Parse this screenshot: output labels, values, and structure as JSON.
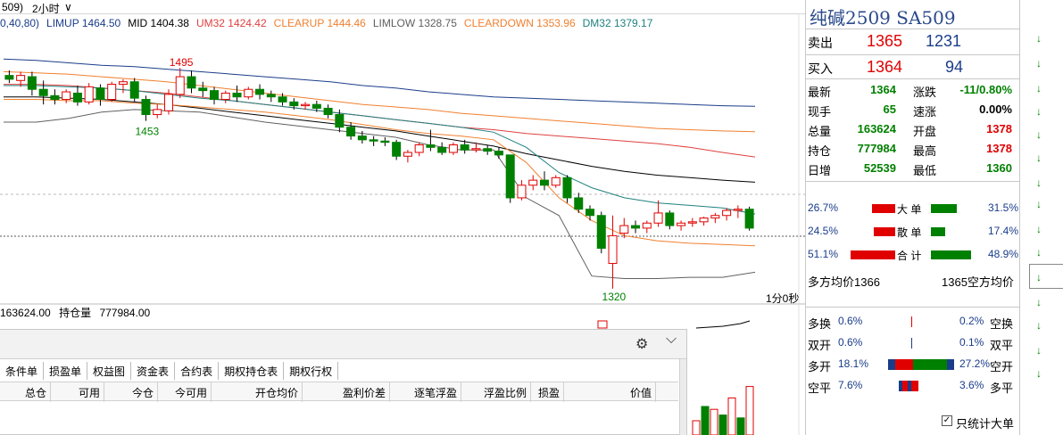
{
  "topbar": {
    "period_prefix": "509)",
    "period_select": "2小时",
    "chevron": "∨"
  },
  "indicators": [
    {
      "text": "0,40,80)",
      "color": "#1a3d8a"
    },
    {
      "text": "LIMUP 1464.50",
      "color": "#1a3d8a"
    },
    {
      "text": "MID 1404.38",
      "color": "#000000"
    },
    {
      "text": "UM32 1424.42",
      "color": "#e04040"
    },
    {
      "text": "CLEARUP 1444.46",
      "color": "#f08030"
    },
    {
      "text": "LIMLOW 1328.75",
      "color": "#606060"
    },
    {
      "text": "CLEARDOWN 1353.96",
      "color": "#f08030"
    },
    {
      "text": "DM32 1379.17",
      "color": "#208080"
    }
  ],
  "chart_data": {
    "type": "candlestick",
    "price_range": [
      1310,
      1505
    ],
    "labels": {
      "high": "1495",
      "low_left": "1453",
      "low": "1320"
    },
    "time_label": "1分0秒",
    "candles": [
      {
        "o": 1489,
        "h": 1493,
        "c": 1486,
        "l": 1483
      },
      {
        "o": 1485,
        "h": 1492,
        "c": 1489,
        "l": 1480
      },
      {
        "o": 1488,
        "h": 1492,
        "c": 1478,
        "l": 1473
      },
      {
        "o": 1478,
        "h": 1485,
        "c": 1473,
        "l": 1466
      },
      {
        "o": 1473,
        "h": 1478,
        "c": 1470,
        "l": 1466
      },
      {
        "o": 1470,
        "h": 1478,
        "c": 1476,
        "l": 1467
      },
      {
        "o": 1475,
        "h": 1481,
        "c": 1468,
        "l": 1465
      },
      {
        "o": 1468,
        "h": 1483,
        "c": 1480,
        "l": 1466
      },
      {
        "o": 1479,
        "h": 1482,
        "c": 1470,
        "l": 1465
      },
      {
        "o": 1470,
        "h": 1484,
        "c": 1482,
        "l": 1468
      },
      {
        "o": 1482,
        "h": 1486,
        "c": 1484,
        "l": 1475
      },
      {
        "o": 1484,
        "h": 1487,
        "c": 1471,
        "l": 1468
      },
      {
        "o": 1470,
        "h": 1473,
        "c": 1458,
        "l": 1453
      },
      {
        "o": 1458,
        "h": 1466,
        "c": 1462,
        "l": 1455
      },
      {
        "o": 1461,
        "h": 1478,
        "c": 1474,
        "l": 1458
      },
      {
        "o": 1474,
        "h": 1495,
        "c": 1488,
        "l": 1471
      },
      {
        "o": 1488,
        "h": 1493,
        "c": 1479,
        "l": 1475
      },
      {
        "o": 1479,
        "h": 1484,
        "c": 1477,
        "l": 1472
      },
      {
        "o": 1477,
        "h": 1480,
        "c": 1470,
        "l": 1466
      },
      {
        "o": 1470,
        "h": 1477,
        "c": 1475,
        "l": 1467
      },
      {
        "o": 1475,
        "h": 1481,
        "c": 1472,
        "l": 1468
      },
      {
        "o": 1472,
        "h": 1480,
        "c": 1478,
        "l": 1470
      },
      {
        "o": 1478,
        "h": 1482,
        "c": 1474,
        "l": 1470
      },
      {
        "o": 1474,
        "h": 1477,
        "c": 1472,
        "l": 1468
      },
      {
        "o": 1472,
        "h": 1475,
        "c": 1468,
        "l": 1465
      },
      {
        "o": 1468,
        "h": 1471,
        "c": 1465,
        "l": 1462
      },
      {
        "o": 1465,
        "h": 1468,
        "c": 1466,
        "l": 1462
      },
      {
        "o": 1466,
        "h": 1469,
        "c": 1463,
        "l": 1460
      },
      {
        "o": 1463,
        "h": 1466,
        "c": 1458,
        "l": 1455
      },
      {
        "o": 1458,
        "h": 1462,
        "c": 1448,
        "l": 1444
      },
      {
        "o": 1448,
        "h": 1452,
        "c": 1441,
        "l": 1438
      },
      {
        "o": 1441,
        "h": 1445,
        "c": 1438,
        "l": 1435
      },
      {
        "o": 1438,
        "h": 1441,
        "c": 1437,
        "l": 1433
      },
      {
        "o": 1437,
        "h": 1440,
        "c": 1436,
        "l": 1433
      },
      {
        "o": 1436,
        "h": 1438,
        "c": 1425,
        "l": 1422
      },
      {
        "o": 1425,
        "h": 1430,
        "c": 1428,
        "l": 1420
      },
      {
        "o": 1428,
        "h": 1436,
        "c": 1434,
        "l": 1425
      },
      {
        "o": 1434,
        "h": 1446,
        "c": 1432,
        "l": 1429
      },
      {
        "o": 1432,
        "h": 1436,
        "c": 1428,
        "l": 1426
      },
      {
        "o": 1428,
        "h": 1436,
        "c": 1434,
        "l": 1426
      },
      {
        "o": 1434,
        "h": 1438,
        "c": 1430,
        "l": 1427
      },
      {
        "o": 1430,
        "h": 1436,
        "c": 1431,
        "l": 1428
      },
      {
        "o": 1431,
        "h": 1434,
        "c": 1429,
        "l": 1426
      },
      {
        "o": 1429,
        "h": 1432,
        "c": 1426,
        "l": 1423
      },
      {
        "o": 1426,
        "h": 1420,
        "c": 1392,
        "l": 1388
      },
      {
        "o": 1392,
        "h": 1406,
        "c": 1402,
        "l": 1390
      },
      {
        "o": 1402,
        "h": 1410,
        "c": 1406,
        "l": 1398
      },
      {
        "o": 1406,
        "h": 1413,
        "c": 1402,
        "l": 1398
      },
      {
        "o": 1402,
        "h": 1410,
        "c": 1408,
        "l": 1400
      },
      {
        "o": 1408,
        "h": 1410,
        "c": 1392,
        "l": 1388
      },
      {
        "o": 1392,
        "h": 1396,
        "c": 1383,
        "l": 1380
      },
      {
        "o": 1383,
        "h": 1386,
        "c": 1378,
        "l": 1374
      },
      {
        "o": 1378,
        "h": 1381,
        "c": 1352,
        "l": 1348
      },
      {
        "o": 1340,
        "h": 1378,
        "c": 1362,
        "l": 1320
      },
      {
        "o": 1364,
        "h": 1376,
        "c": 1370,
        "l": 1360
      },
      {
        "o": 1370,
        "h": 1374,
        "c": 1368,
        "l": 1364
      },
      {
        "o": 1368,
        "h": 1374,
        "c": 1372,
        "l": 1364
      },
      {
        "o": 1372,
        "h": 1390,
        "c": 1380,
        "l": 1369
      },
      {
        "o": 1380,
        "h": 1382,
        "c": 1370,
        "l": 1367
      },
      {
        "o": 1370,
        "h": 1374,
        "c": 1372,
        "l": 1366
      },
      {
        "o": 1372,
        "h": 1376,
        "c": 1373,
        "l": 1369
      },
      {
        "o": 1373,
        "h": 1377,
        "c": 1376,
        "l": 1370
      },
      {
        "o": 1376,
        "h": 1380,
        "c": 1378,
        "l": 1372
      },
      {
        "o": 1378,
        "h": 1384,
        "c": 1382,
        "l": 1374
      },
      {
        "o": 1382,
        "h": 1386,
        "c": 1383,
        "l": 1376
      },
      {
        "o": 1383,
        "h": 1385,
        "c": 1368,
        "l": 1366
      }
    ],
    "bands": {
      "limup": [
        1502,
        1501,
        1499,
        1497,
        1496,
        1494,
        1492,
        1490,
        1488,
        1486,
        1484,
        1481,
        1479,
        1476,
        1474,
        1472,
        1471,
        1470,
        1469,
        1468,
        1467,
        1466,
        1465,
        1464.5
      ],
      "clearup": [
        1492,
        1491,
        1490,
        1488,
        1486,
        1484,
        1481,
        1478,
        1475,
        1472,
        1469,
        1466,
        1464,
        1462,
        1459,
        1457,
        1455,
        1453,
        1451,
        1449,
        1447,
        1446,
        1445,
        1444.46
      ],
      "um32": [
        1482,
        1482,
        1481,
        1479,
        1477,
        1475,
        1472,
        1469,
        1466,
        1463,
        1460,
        1457,
        1454,
        1451,
        1448,
        1446,
        1443,
        1441,
        1439,
        1437,
        1435,
        1432,
        1428,
        1424.42
      ],
      "mid": [
        1472,
        1472,
        1471,
        1470,
        1468,
        1466,
        1463,
        1460,
        1457,
        1454,
        1451,
        1448,
        1445,
        1441,
        1437,
        1433,
        1427,
        1422,
        1417,
        1413,
        1410,
        1408,
        1406,
        1404.38
      ],
      "dm32": [
        1481,
        1481,
        1480,
        1479,
        1477,
        1474,
        1471,
        1469,
        1466,
        1463,
        1460,
        1457,
        1454,
        1451,
        1448,
        1444,
        1432,
        1412,
        1400,
        1392,
        1388,
        1386,
        1384,
        1379.17
      ],
      "cleardown": [
        1470,
        1470,
        1469,
        1469,
        1467,
        1466,
        1464,
        1462,
        1460,
        1457,
        1454,
        1450,
        1446,
        1443,
        1441,
        1438,
        1420,
        1392,
        1374,
        1362,
        1358,
        1356,
        1355,
        1353.96
      ],
      "limlow": [
        1452,
        1452,
        1455,
        1460,
        1462,
        1461,
        1460,
        1456,
        1452,
        1449,
        1446,
        1443,
        1440,
        1434,
        1430,
        1430,
        1392,
        1378,
        1330,
        1328,
        1328,
        1329,
        1329,
        1333
      ]
    },
    "volume_header": {
      "volume": "163624.00",
      "oi_label": "持仓量",
      "oi": "777984.00"
    },
    "volume_bars": [
      10,
      20,
      18,
      14,
      26,
      12,
      34
    ]
  },
  "panel": {
    "tabs": [
      "条件单",
      "损盈单",
      "权益图",
      "资金表",
      "合约表",
      "期权持仓表",
      "期权行权"
    ],
    "columns": [
      "总仓",
      "可用",
      "今仓",
      "今可用",
      "开仓均价",
      "盈利价差",
      "逐笔浮盈",
      "浮盈比例",
      "损盈",
      "价值"
    ],
    "gear": "⚙",
    "collapse": "⌵"
  },
  "quote": {
    "title": "纯碱2509  SA509",
    "ask_label": "卖出",
    "ask_price": "1365",
    "ask_vol": "1231",
    "bid_label": "买入",
    "bid_price": "1364",
    "bid_vol": "94",
    "stats": [
      {
        "l1": "最新",
        "v1": "1364",
        "c1": "green",
        "l2": "涨跌",
        "v2": "-11/0.80%",
        "c2": "green"
      },
      {
        "l1": "现手",
        "v1": "65",
        "c1": "green",
        "l2": "速涨",
        "v2": "0.00%",
        "c2": "black"
      },
      {
        "l1": "总量",
        "v1": "163624",
        "c1": "green",
        "l2": "开盘",
        "v2": "1378",
        "c2": "red"
      },
      {
        "l1": "持仓",
        "v1": "777984",
        "c1": "green",
        "l2": "最高",
        "v2": "1378",
        "c2": "red"
      },
      {
        "l1": "日增",
        "v1": "52539",
        "c1": "green",
        "l2": "最低",
        "v2": "1360",
        "c2": "green"
      }
    ],
    "flow": [
      {
        "lp": "26.7%",
        "label": "大 单",
        "rp": "31.5%",
        "red": 0.267,
        "green": 0.315
      },
      {
        "lp": "24.5%",
        "label": "散 单",
        "rp": "17.4%",
        "red": 0.245,
        "green": 0.174
      },
      {
        "lp": "51.1%",
        "label": "合 计",
        "rp": "48.9%",
        "red": 0.511,
        "green": 0.489
      }
    ],
    "avg_long": "多方均价1366",
    "avg_short": "1365空方均价",
    "trade_types": [
      {
        "l": "多换",
        "lp": "0.6%",
        "rp": "0.2%",
        "r": "空换"
      },
      {
        "l": "双开",
        "lp": "0.6%",
        "rp": "0.1%",
        "r": "双平"
      },
      {
        "l": "多开",
        "lp": "18.1%",
        "rp": "27.2%",
        "r": "空开"
      },
      {
        "l": "空平",
        "lp": "7.6%",
        "rp": "3.6%",
        "r": "多平"
      }
    ],
    "checkbox_label": "只统计大单",
    "checkbox_mark": "✓"
  },
  "strip": {
    "arrow": "↓"
  }
}
